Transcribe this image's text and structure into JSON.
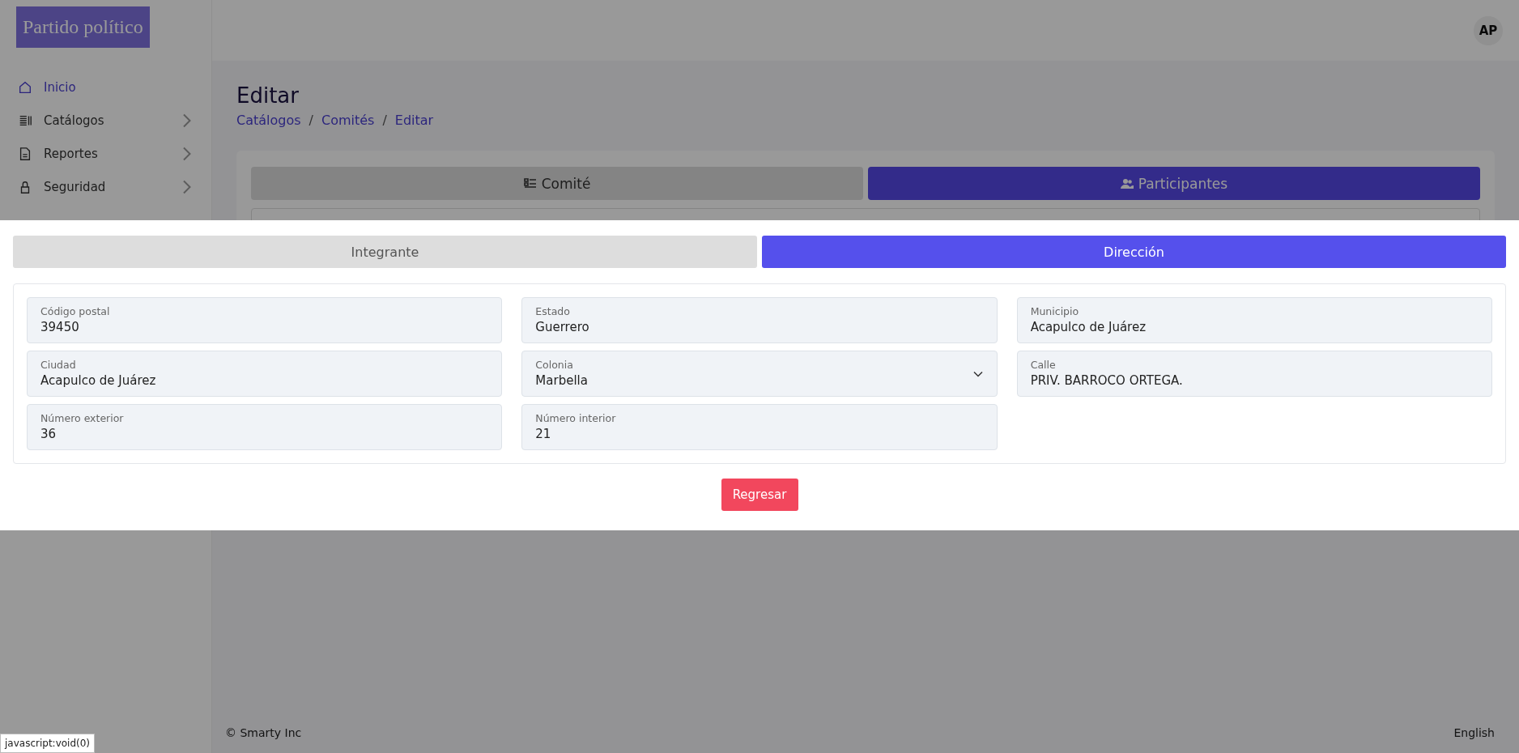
{
  "sidebar": {
    "logo": "Partido político",
    "items": [
      {
        "label": "Inicio",
        "selected": true,
        "expandable": false
      },
      {
        "label": "Catálogos",
        "selected": false,
        "expandable": true
      },
      {
        "label": "Reportes",
        "selected": false,
        "expandable": true
      },
      {
        "label": "Seguridad",
        "selected": false,
        "expandable": true
      }
    ]
  },
  "topbar": {
    "avatar": "AP"
  },
  "page": {
    "title": "Editar",
    "breadcrumbs": [
      "Catálogos",
      "Comités",
      "Editar"
    ],
    "breadcrumb_separator": "/",
    "tabs": [
      {
        "label": "Comité",
        "selected": false
      },
      {
        "label": "Participantes",
        "selected": true
      }
    ]
  },
  "modal": {
    "tabs": [
      {
        "label": "Integrante",
        "selected": false
      },
      {
        "label": "Dirección",
        "selected": true
      }
    ],
    "fields": [
      {
        "label": "Código postal",
        "value": "39450",
        "kind": "text"
      },
      {
        "label": "Estado",
        "value": "Guerrero",
        "kind": "text"
      },
      {
        "label": "Municipio",
        "value": "Acapulco de Juárez",
        "kind": "text"
      },
      {
        "label": "Ciudad",
        "value": "Acapulco de Juárez",
        "kind": "text"
      },
      {
        "label": "Colonia",
        "value": "Marbella",
        "kind": "select"
      },
      {
        "label": "Calle",
        "value": "PRIV. BARROCO ORTEGA.",
        "kind": "text"
      },
      {
        "label": "Número exterior",
        "value": "36",
        "kind": "text"
      },
      {
        "label": "Número interior",
        "value": "21",
        "kind": "text"
      }
    ],
    "button": "Regresar"
  },
  "footer": {
    "copyright": "© Smarty Inc",
    "language": "English"
  },
  "status_tooltip": "javascript:void(0)"
}
